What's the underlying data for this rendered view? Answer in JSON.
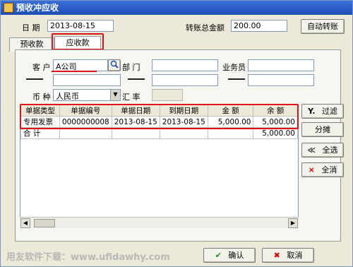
{
  "window": {
    "title": "预收冲应收"
  },
  "header": {
    "date_label": "日 期",
    "date_value": "2013-08-15",
    "transfer_label": "转账总金额",
    "transfer_value": "200.00",
    "auto_button": "自动转账"
  },
  "tabs": [
    {
      "label": "预收款"
    },
    {
      "label": "应收款"
    }
  ],
  "form": {
    "customer_label": "客 户",
    "customer_value": "A公司",
    "dept_label": "部 门",
    "dept_value": "",
    "staff_label": "业务员",
    "staff_value": "",
    "dash": "—",
    "currency_label": "币 种",
    "currency_value": "人民币",
    "rate_label": "汇 率",
    "rate_value": ""
  },
  "table": {
    "columns": [
      "单据类型",
      "单据编号",
      "单据日期",
      "到期日期",
      "金 额",
      "余 额"
    ],
    "rows": [
      [
        "专用发票",
        "0000000008",
        "2013-08-15",
        "2013-08-15",
        "5,000.00",
        "5,000.00"
      ]
    ],
    "total_label": "合 计",
    "total_balance": "5,000.00"
  },
  "side_buttons": {
    "filter": "过滤",
    "split": "分摊",
    "select_all": "全选",
    "clear_all": "全消"
  },
  "footer": {
    "ok": "确认",
    "cancel": "取消",
    "watermark": "用友软件下载：www.ufidawhy.com"
  },
  "colors": {
    "highlight": "#e0101a",
    "title_bar": "#1d4fb6"
  }
}
